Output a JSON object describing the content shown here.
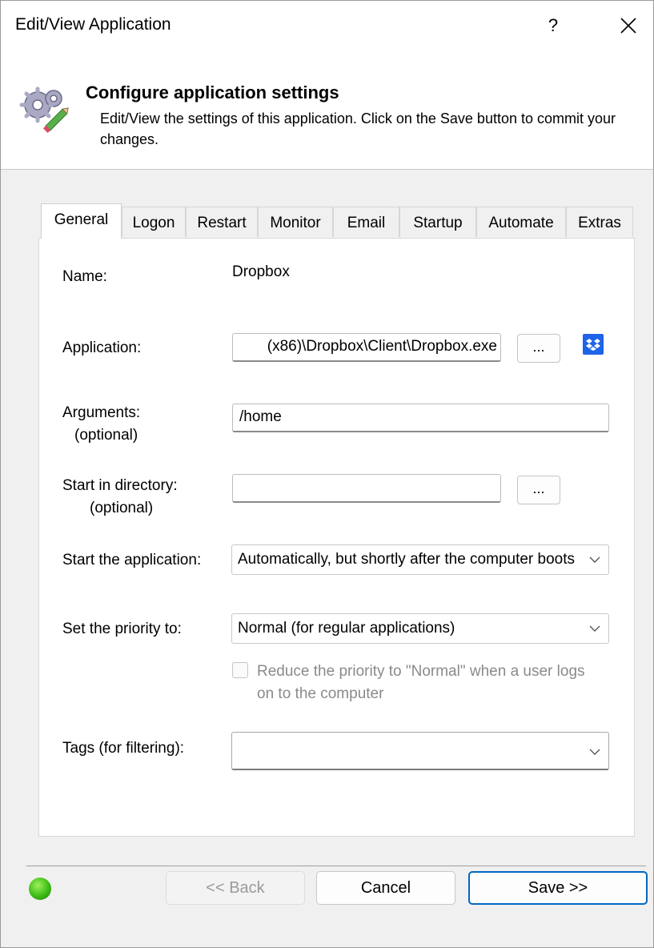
{
  "window": {
    "title": "Edit/View Application",
    "help_label": "?",
    "header": {
      "title": "Configure application settings",
      "description": "Edit/View the settings of this application. Click on the Save button to commit your changes."
    }
  },
  "tabs": [
    {
      "label": "General",
      "active": true
    },
    {
      "label": "Logon"
    },
    {
      "label": "Restart"
    },
    {
      "label": "Monitor"
    },
    {
      "label": "Email"
    },
    {
      "label": "Startup"
    },
    {
      "label": "Automate"
    },
    {
      "label": "Extras"
    }
  ],
  "form": {
    "name_label": "Name:",
    "name_value": "Dropbox",
    "application_label": "Application:",
    "application_value": "(x86)\\Dropbox\\Client\\Dropbox.exe",
    "browse_label": "...",
    "arguments_label": "Arguments:",
    "arguments_optional": "(optional)",
    "arguments_value": "/home",
    "start_dir_label": "Start in directory:",
    "start_dir_optional": "(optional)",
    "start_dir_value": "",
    "start_app_label": "Start the application:",
    "start_app_value": "Automatically, but shortly after the computer boots",
    "priority_label": "Set the priority to:",
    "priority_value": "Normal (for regular applications)",
    "reduce_priority_label": "Reduce the priority to \"Normal\" when a user logs on to the computer",
    "reduce_priority_checked": false,
    "tags_label": "Tags (for filtering):",
    "tags_value": ""
  },
  "footer": {
    "back_label": "<< Back",
    "cancel_label": "Cancel",
    "save_label": "Save >>",
    "status_color": "#3dbb14"
  },
  "colors": {
    "accent": "#0067c0",
    "dropbox": "#1f63e8"
  }
}
